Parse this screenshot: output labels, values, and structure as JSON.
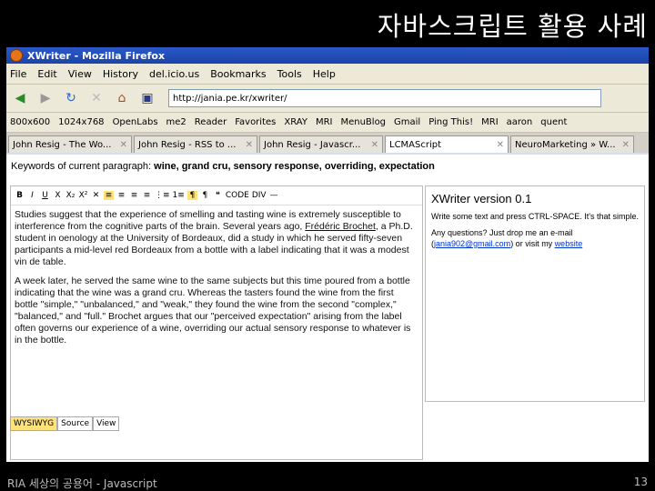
{
  "slide": {
    "title": "자바스크립트 활용 사례",
    "footer_left": "RIA 세상의 공용어 - Javascript",
    "page_number": "13"
  },
  "browser": {
    "window_title": "XWriter - Mozilla Firefox",
    "menu": [
      "File",
      "Edit",
      "View",
      "History",
      "del.icio.us",
      "Bookmarks",
      "Tools",
      "Help"
    ],
    "url": "http://jania.pe.kr/xwriter/",
    "bookmarks": [
      "800x600",
      "1024x768",
      "OpenLabs",
      "me2",
      "Reader",
      "Favorites",
      "XRAY",
      "MRI",
      "MenuBlog",
      "Gmail",
      "Ping This!",
      "MRI",
      "aaron",
      "quent"
    ],
    "tabs": [
      "John Resig - The Wo...",
      "John Resig - RSS to ...",
      "John Resig - Javascr...",
      "LCMAScript",
      "NeuroMarketing » W..."
    ]
  },
  "page": {
    "keywords_label": "Keywords of current paragraph:",
    "keywords": "wine, grand cru, sensory response, overriding, expectation",
    "toolbar": [
      "B",
      "I",
      "U",
      "X",
      "X₂",
      "X²",
      "✕",
      "≡",
      "≡",
      "≡",
      "≡",
      "⋮≡",
      "1≡",
      "¶",
      "¶",
      "❝",
      "CODE",
      "DIV",
      "—"
    ],
    "paragraph1_a": "Studies suggest that the experience of smelling and tasting wine is extremely susceptible to interference from the cognitive parts of the brain. Several years ago, ",
    "paragraph1_link": "Frédéric Brochet",
    "paragraph1_b": ", a Ph.D. student in oenology at the University of Bordeaux, did a study in which he served fifty-seven participants a mid-level red Bordeaux from a bottle with a label indicating that it was a modest vin de table.",
    "paragraph2": "A week later, he served the same wine to the same subjects but this time poured from a bottle indicating that the wine was a grand cru. Whereas the tasters found the wine from the first bottle \"simple,\" \"unbalanced,\" and \"weak,\" they found the wine from the second \"complex,\" \"balanced,\" and \"full.\" Brochet argues that our \"perceived expectation\" arising from the label often governs our experience of a wine, overriding our actual sensory response to whatever is in the bottle.",
    "editor_tabs": [
      "WYSIWYG",
      "Source",
      "View"
    ],
    "side_title": "XWriter version 0.1",
    "side_text1": "Write some text and press CTRL-SPACE. It's that simple.",
    "side_text2": "Any questions? Just drop me an e-mail (",
    "side_email": "jania902@gmail.com",
    "side_text3": ") or visit my ",
    "side_website": "website"
  }
}
